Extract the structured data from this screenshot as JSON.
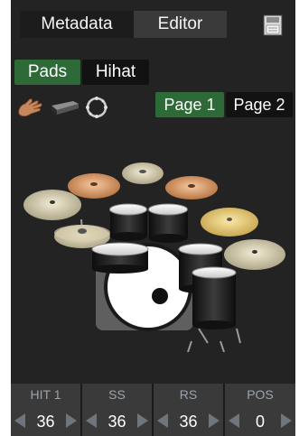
{
  "tabs": {
    "metadata": "Metadata",
    "editor": "Editor"
  },
  "subtabs": {
    "pads": "Pads",
    "hihat": "Hihat"
  },
  "pages": {
    "page1": "Page 1",
    "page2": "Page 2"
  },
  "instrument_icons": [
    "hand-icon",
    "stick-icon",
    "tambourine-icon"
  ],
  "params": [
    {
      "label": "HIT 1",
      "value": "36"
    },
    {
      "label": "SS",
      "value": "36"
    },
    {
      "label": "RS",
      "value": "36"
    },
    {
      "label": "POS",
      "value": "0"
    }
  ],
  "colors": {
    "accent_green": "#2d6a37",
    "background": "#232323",
    "panel": "#3a3a3a"
  }
}
